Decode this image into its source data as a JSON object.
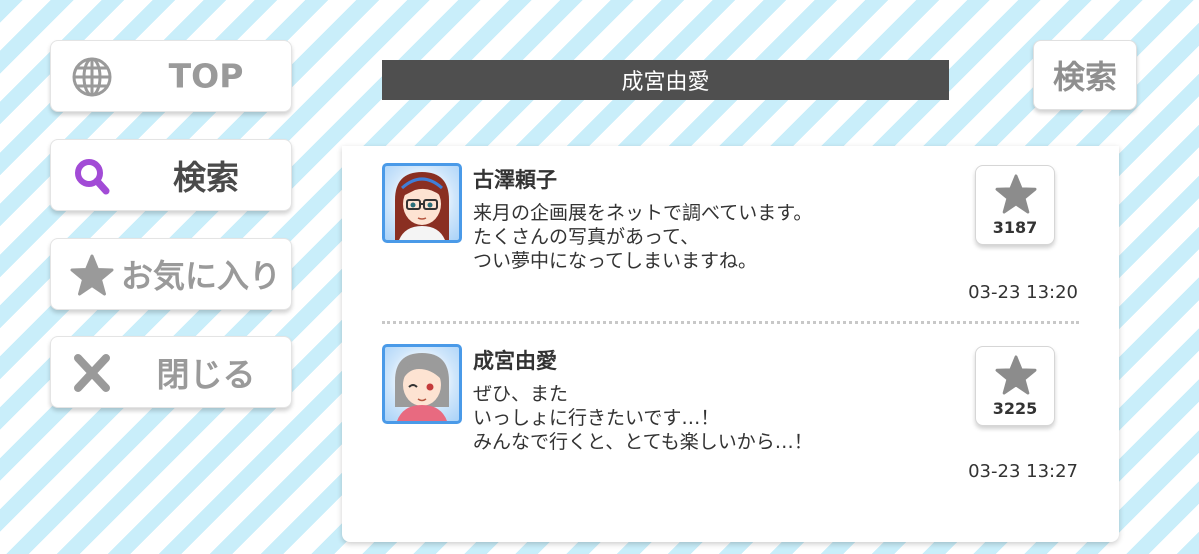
{
  "sidebar": {
    "top": {
      "label": "TOP",
      "icon": "globe-icon"
    },
    "search": {
      "label": "検索",
      "icon": "magnifier-icon",
      "icon_color": "#a24bd6"
    },
    "favorites": {
      "label": "お気に入り",
      "icon": "star-icon"
    },
    "close": {
      "label": "閉じる",
      "icon": "close-x-icon"
    }
  },
  "header": {
    "title": "成宮由愛",
    "search_label": "検索"
  },
  "posts": [
    {
      "author": "古澤頼子",
      "lines": [
        "来月の企画展をネットで調べています。",
        "たくさんの写真があって、",
        "つい夢中になってしまいますね。"
      ],
      "likes": "3187",
      "timestamp": "03-23 13:20"
    },
    {
      "author": "成宮由愛",
      "lines": [
        "ぜひ、また",
        "いっしょに行きたいです…！",
        "みんなで行くと、とても楽しいから…！"
      ],
      "likes": "3225",
      "timestamp": "03-23 13:27"
    }
  ],
  "colors": {
    "stripe": "#c9eefa",
    "title_bar": "#4f4f4f",
    "avatar_border": "#4a9ae8",
    "star": "#8c8c8c"
  }
}
